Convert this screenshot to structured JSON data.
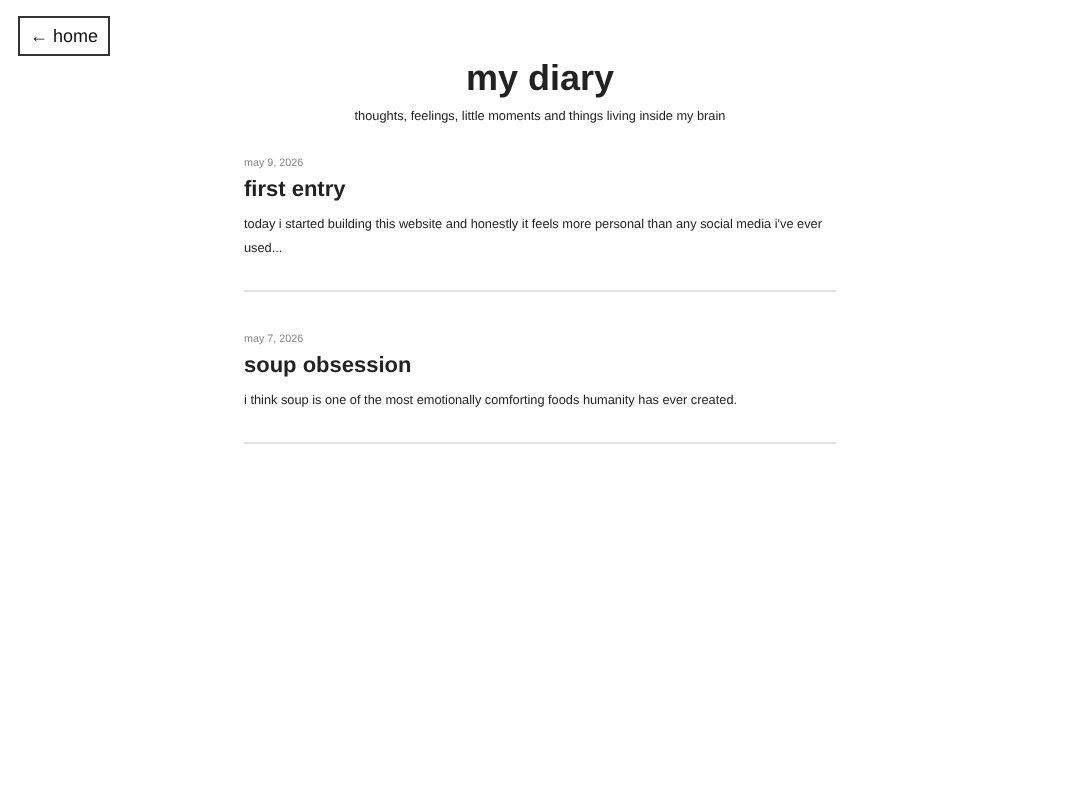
{
  "home_button": {
    "label": "← home"
  },
  "header": {
    "title": "my diary",
    "subtitle": "thoughts, feelings, little moments and things living inside my brain"
  },
  "entries": [
    {
      "date": "may 9, 2026",
      "title": "first entry",
      "excerpt": "today i started building this website and honestly it feels more personal than any social media i've ever used..."
    },
    {
      "date": "may 7, 2026",
      "title": "soup obsession",
      "excerpt": "i think soup is one of the most emotionally comforting foods humanity has ever created."
    }
  ]
}
